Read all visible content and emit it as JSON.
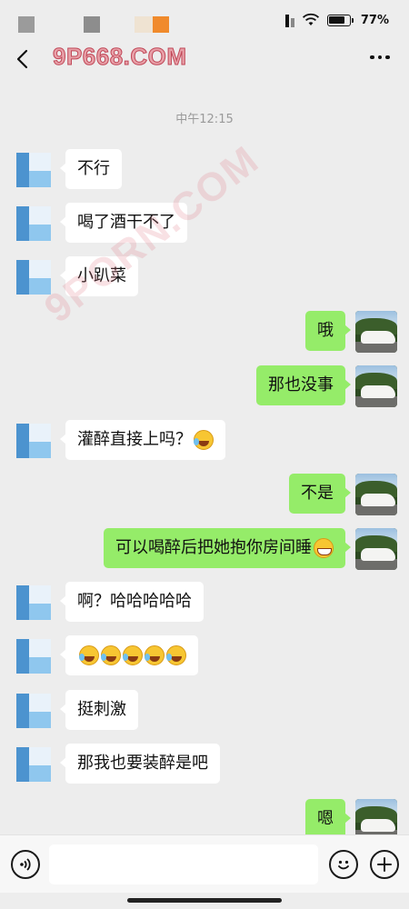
{
  "status_bar": {
    "battery_text": "77%",
    "battery_level": 0.77
  },
  "nav": {
    "title": "9P668.COM"
  },
  "watermark": "9PORN.COM",
  "timestamp": "中午12:15",
  "messages": [
    {
      "side": "in",
      "text": "不行"
    },
    {
      "side": "in",
      "text": "喝了酒干不了"
    },
    {
      "side": "in",
      "text": "小趴菜"
    },
    {
      "side": "out",
      "text": "哦"
    },
    {
      "side": "out",
      "text": "那也没事"
    },
    {
      "side": "in",
      "text": "灌醉直接上吗？",
      "emoji": "laugh-cry-emoji"
    },
    {
      "side": "out",
      "text": "不是"
    },
    {
      "side": "out",
      "text": "可以喝醉后把她抱你房间睡",
      "emoji": "grin-emoji"
    },
    {
      "side": "in",
      "text": "啊？哈哈哈哈哈"
    },
    {
      "side": "in",
      "text": "",
      "emoji_count": 5,
      "emoji": "laugh-cry-emoji"
    },
    {
      "side": "in",
      "text": "挺刺激"
    },
    {
      "side": "in",
      "text": "那我也要装醉是吧"
    },
    {
      "side": "out",
      "text": "嗯"
    }
  ],
  "input_bar": {
    "voice_icon": "voice-icon",
    "emoji_icon": "emoji-icon",
    "plus_icon": "plus-icon",
    "placeholder": ""
  },
  "colors": {
    "background": "#ededed",
    "bubble_in": "#ffffff",
    "bubble_out": "#95ec69"
  }
}
